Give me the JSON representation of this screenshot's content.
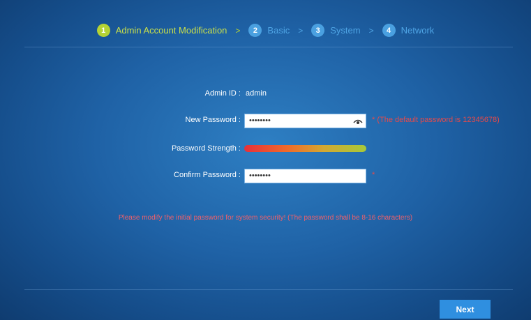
{
  "steps": [
    {
      "number": "1",
      "label": "Admin Account Modification"
    },
    {
      "number": "2",
      "label": "Basic"
    },
    {
      "number": "3",
      "label": "System"
    },
    {
      "number": "4",
      "label": "Network"
    }
  ],
  "step_separator": ">",
  "active_step": 1,
  "form": {
    "admin_id_label": "Admin ID :",
    "admin_id_value": "admin",
    "new_password_label": "New Password :",
    "new_password_value": "••••••••",
    "new_password_hint": "* (The default password is 12345678)",
    "strength_label": "Password Strength :",
    "strength_level": 1.0,
    "confirm_password_label": "Confirm Password :",
    "confirm_password_value": "••••••••",
    "required_mark": "*"
  },
  "warning": "Please modify the initial password for system security! (The password shall be 8-16 characters)",
  "next_label": "Next",
  "colors": {
    "active_step": "#b5d334",
    "inactive_step": "#4ea4e4",
    "error_text": "#e84a4a",
    "button": "#2f8fe0"
  },
  "icons": {
    "password_visibility": "eye-icon"
  }
}
